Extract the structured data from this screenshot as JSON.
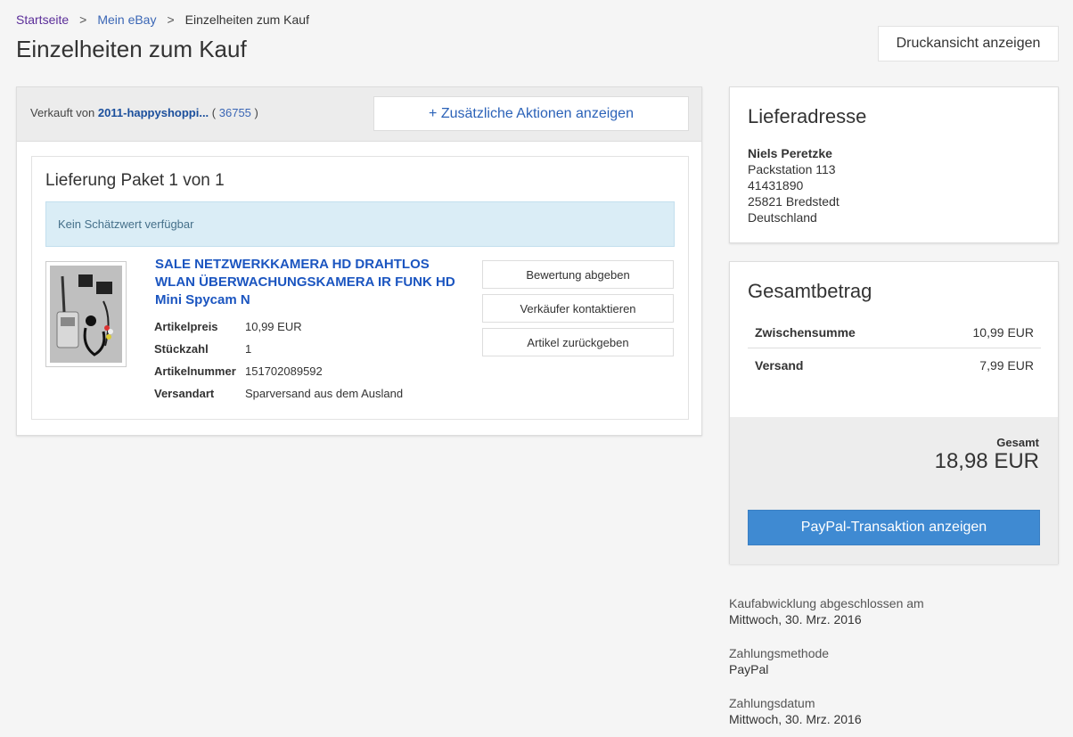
{
  "breadcrumb": {
    "home": "Startseite",
    "my_ebay": "Mein eBay",
    "current": "Einzelheiten zum Kauf",
    "separator": ">"
  },
  "page_title": "Einzelheiten zum Kauf",
  "print_button": "Druckansicht anzeigen",
  "order": {
    "sold_by_label": "Verkauft von",
    "seller_name": "2011-happyshoppi...",
    "seller_score_open": "(",
    "seller_score": "36755",
    "seller_score_close": ")",
    "more_actions": "+ Zusätzliche Aktionen anzeigen",
    "package_title": "Lieferung Paket 1 von 1",
    "estimate_notice": "Kein Schätzwert verfügbar",
    "item": {
      "title": "SALE NETZWERKKAMERA HD DRAHTLOS WLAN ÜBERWACHUNGSKAMERA IR FUNK HD Mini Spycam N",
      "details": [
        {
          "label": "Artikelpreis",
          "value": "10,99 EUR"
        },
        {
          "label": "Stückzahl",
          "value": "1"
        },
        {
          "label": "Artikelnummer",
          "value": "151702089592"
        },
        {
          "label": "Versandart",
          "value": "Sparversand aus dem Ausland"
        }
      ]
    },
    "buttons": {
      "rate": "Bewertung abgeben",
      "contact": "Verkäufer kontaktieren",
      "return": "Artikel zurückgeben"
    }
  },
  "shipping_address": {
    "heading": "Lieferadresse",
    "name": "Niels Peretzke",
    "line1": "Packstation 113",
    "line2": "41431890",
    "line3": "25821 Bredstedt",
    "country": "Deutschland"
  },
  "totals": {
    "heading": "Gesamtbetrag",
    "subtotal_label": "Zwischensumme",
    "subtotal_value": "10,99 EUR",
    "shipping_label": "Versand",
    "shipping_value": "7,99 EUR",
    "total_label": "Gesamt",
    "total_value": "18,98 EUR",
    "paypal_button": "PayPal-Transaktion anzeigen"
  },
  "meta": {
    "completed_label": "Kaufabwicklung abgeschlossen am",
    "completed_value": "Mittwoch, 30. Mrz. 2016",
    "payment_method_label": "Zahlungsmethode",
    "payment_method_value": "PayPal",
    "payment_date_label": "Zahlungsdatum",
    "payment_date_value": "Mittwoch, 30. Mrz. 2016"
  },
  "colors": {
    "link_blue": "#1b55c0",
    "visited_purple": "#5b2e99",
    "paypal_button": "#3f8ad2",
    "info_banner": "#daedf6"
  }
}
